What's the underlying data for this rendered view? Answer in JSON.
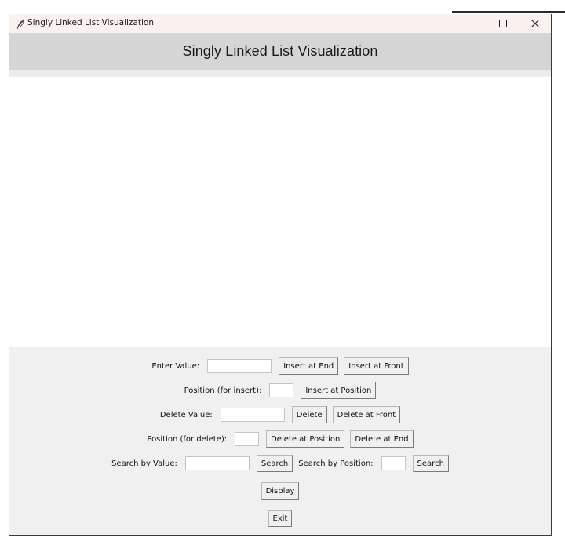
{
  "window": {
    "title": "Singly Linked List Visualization",
    "controls": {
      "minimize": "—",
      "maximize": "☐",
      "close": "✕"
    }
  },
  "header": {
    "title": "Singly Linked List Visualization"
  },
  "controls": {
    "insert_value": {
      "label": "Enter Value:",
      "value": "",
      "insert_end": "Insert at End",
      "insert_front": "Insert at Front"
    },
    "insert_position": {
      "label": "Position (for insert):",
      "value": "",
      "insert_at_position": "Insert at Position"
    },
    "delete_value": {
      "label": "Delete Value:",
      "value": "",
      "delete": "Delete",
      "delete_front": "Delete at Front"
    },
    "delete_position": {
      "label": "Position (for delete):",
      "value": "",
      "delete_at_position": "Delete at Position",
      "delete_end": "Delete at End"
    },
    "search": {
      "value_label": "Search by Value:",
      "value": "",
      "search_value_button": "Search",
      "position_label": "Search by Position:",
      "position": "",
      "search_position_button": "Search"
    },
    "display": "Display",
    "exit": "Exit"
  },
  "icons": {
    "app": "feather-icon",
    "minimize": "minimize-icon",
    "maximize": "maximize-icon",
    "close": "close-icon"
  },
  "colors": {
    "titlebar": "#fbf1f1",
    "header": "#d5d5d5",
    "control_panel": "#f0f0f0",
    "canvas": "#ffffff"
  }
}
